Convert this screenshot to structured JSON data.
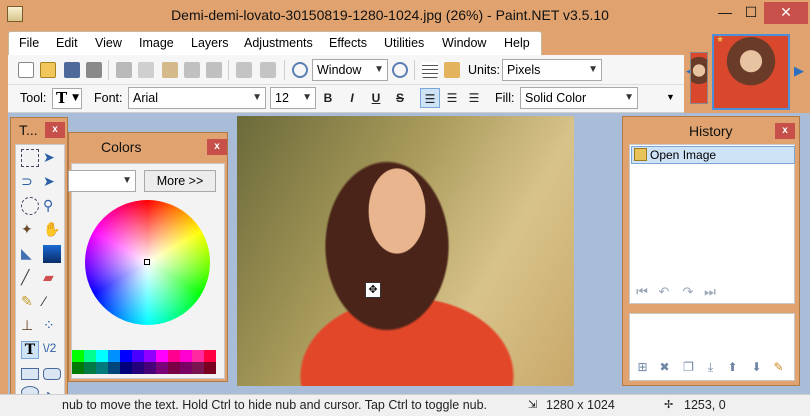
{
  "window": {
    "title": "Demi-demi-lovato-30150819-1280-1024.jpg (26%) - Paint.NET v3.5.10",
    "minimize": "—",
    "maximize": "☐",
    "close": "✕"
  },
  "menu": [
    "File",
    "Edit",
    "View",
    "Image",
    "Layers",
    "Adjustments",
    "Effects",
    "Utilities",
    "Window",
    "Help"
  ],
  "toolbar": {
    "zoom_value": "Window",
    "units_label": "Units:",
    "units_value": "Pixels"
  },
  "text_toolbar": {
    "tool_label": "Tool:",
    "tool_glyph": "T",
    "font_label": "Font:",
    "font_value": "Arial",
    "size_value": "12",
    "bold": "B",
    "italic": "I",
    "underline": "U",
    "strike": "S",
    "fill_label": "Fill:",
    "fill_value": "Solid Color"
  },
  "tools_panel": {
    "title": "T...",
    "close": "x"
  },
  "colors_panel": {
    "title": "Colors",
    "close": "x",
    "more_button": "More >>"
  },
  "history_panel": {
    "title": "History",
    "close": "x",
    "items": [
      "Open Image"
    ]
  },
  "status": {
    "hint": "Drag the nub to move the text. Hold Ctrl to hide nub and cursor. Tap Ctrl to toggle nub.",
    "hint_visible": "nub to move the text. Hold Ctrl to hide nub and cursor. Tap Ctrl to toggle nub.",
    "image_size": "1280 x 1024",
    "cursor_pos": "1253, 0"
  },
  "colors": {
    "accent_bg": "#e0a36f",
    "close_red": "#c7504a",
    "selection_blue": "#cfe3f7",
    "workspace": "#a9bdd9"
  }
}
